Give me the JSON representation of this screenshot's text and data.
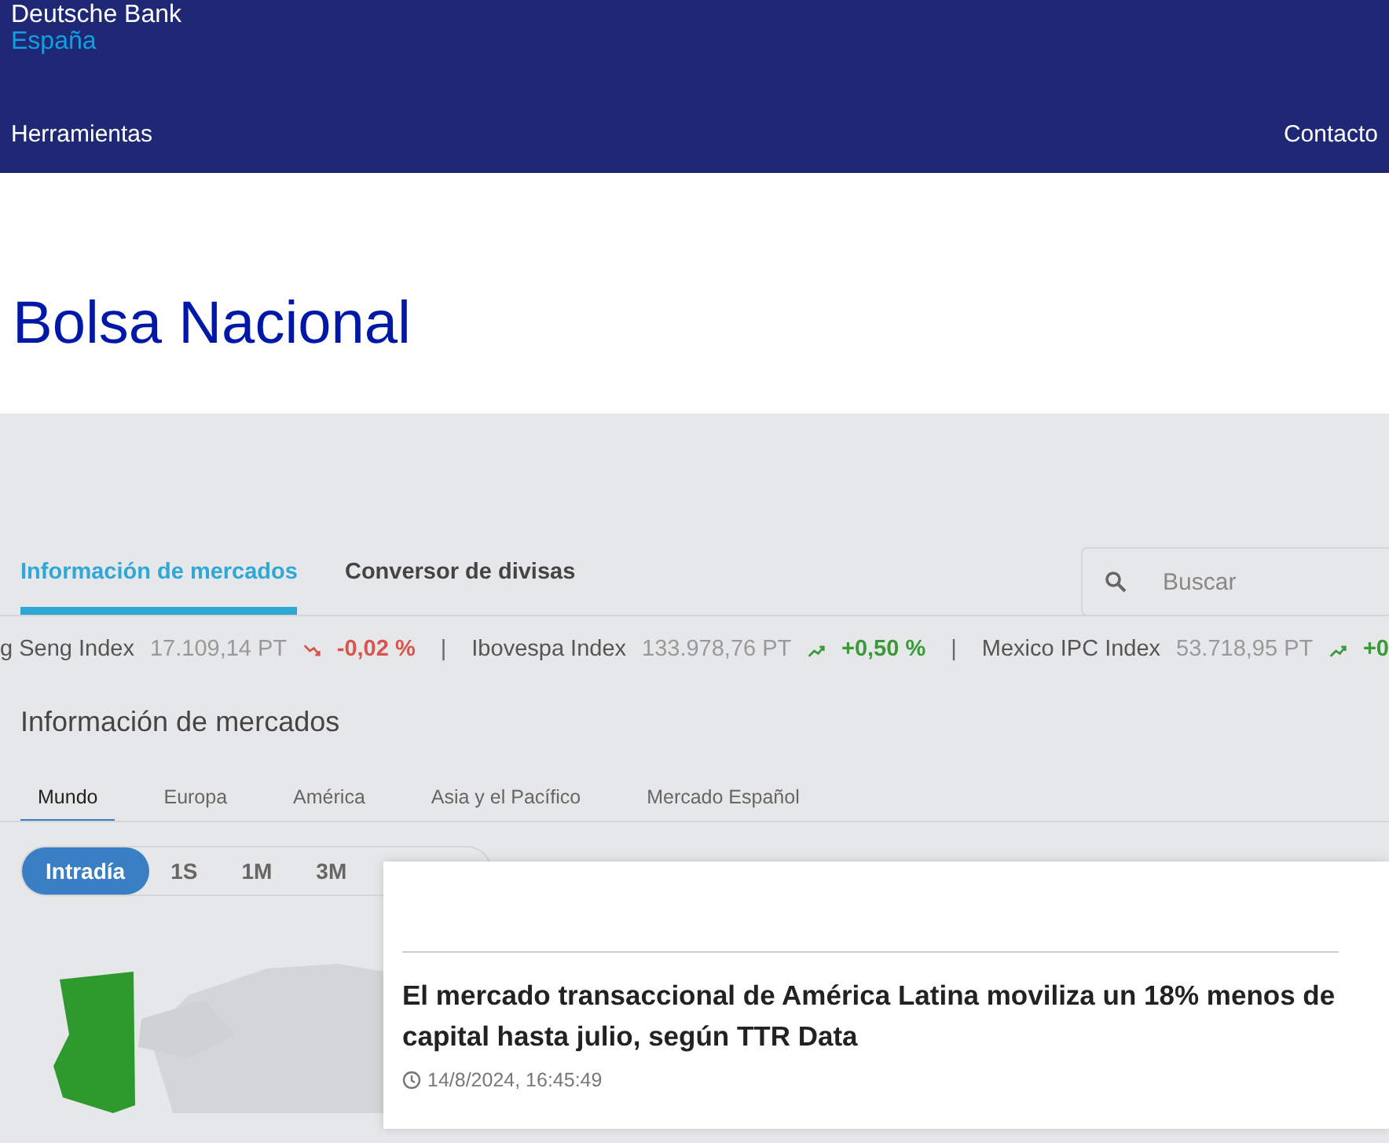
{
  "brand": {
    "name": "Deutsche Bank",
    "region": "España"
  },
  "nav": {
    "left": "Herramientas",
    "right": "Contacto"
  },
  "page_title": "Bolsa Nacional",
  "tabs": [
    {
      "label": "Información de mercados",
      "selected": true
    },
    {
      "label": "Conversor de divisas",
      "selected": false
    }
  ],
  "search": {
    "placeholder": "Buscar"
  },
  "ticker": [
    {
      "name": "g Seng Index",
      "value": "17.109,14 PT",
      "kind": "down",
      "change": "-0,02 %"
    },
    {
      "name": "Ibovespa Index",
      "value": "133.978,76 PT",
      "kind": "up",
      "change": "+0,50 %"
    },
    {
      "name": "Mexico IPC Index",
      "value": "53.718,95 PT",
      "kind": "up",
      "change": "+0"
    }
  ],
  "ticker_separator": "|",
  "section_title": "Información de mercados",
  "region_tabs": [
    {
      "label": "Mundo",
      "selected": true
    },
    {
      "label": "Europa",
      "selected": false
    },
    {
      "label": "América",
      "selected": false
    },
    {
      "label": "Asia y el Pacífico",
      "selected": false
    },
    {
      "label": "Mercado Español",
      "selected": false
    }
  ],
  "periods": [
    {
      "label": "Intradía",
      "selected": true
    },
    {
      "label": "1S",
      "selected": false
    },
    {
      "label": "1M",
      "selected": false
    },
    {
      "label": "3M",
      "selected": false
    }
  ],
  "news": {
    "headline": "El mercado transaccional de América Latina moviliza un 18% menos de capital hasta julio, según TTR Data",
    "timestamp": "14/8/2024, 16:45:49"
  }
}
